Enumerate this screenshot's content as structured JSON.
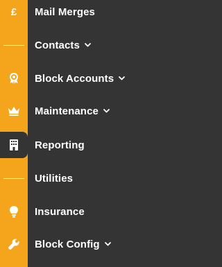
{
  "nav": {
    "items": [
      {
        "label": "Mail Merges",
        "icon": "pound-sterling-icon",
        "has_chevron": false
      },
      {
        "label": "Contacts",
        "icon": "divider-line",
        "has_chevron": true
      },
      {
        "label": "Block Accounts",
        "icon": "award-badge-icon",
        "has_chevron": true
      },
      {
        "label": "Maintenance",
        "icon": "crown-icon",
        "has_chevron": true
      },
      {
        "label": "Reporting",
        "icon": "building-icon",
        "has_chevron": false,
        "active": true
      },
      {
        "label": "Utilities",
        "icon": "divider-line",
        "has_chevron": false
      },
      {
        "label": "Insurance",
        "icon": "lightbulb-icon",
        "has_chevron": false
      },
      {
        "label": "Block Config",
        "icon": "wrench-icon",
        "has_chevron": true
      }
    ],
    "pound_symbol": "£"
  },
  "colors": {
    "accent": "#F5A51C",
    "background": "#343434",
    "text": "#FFFFFF"
  }
}
